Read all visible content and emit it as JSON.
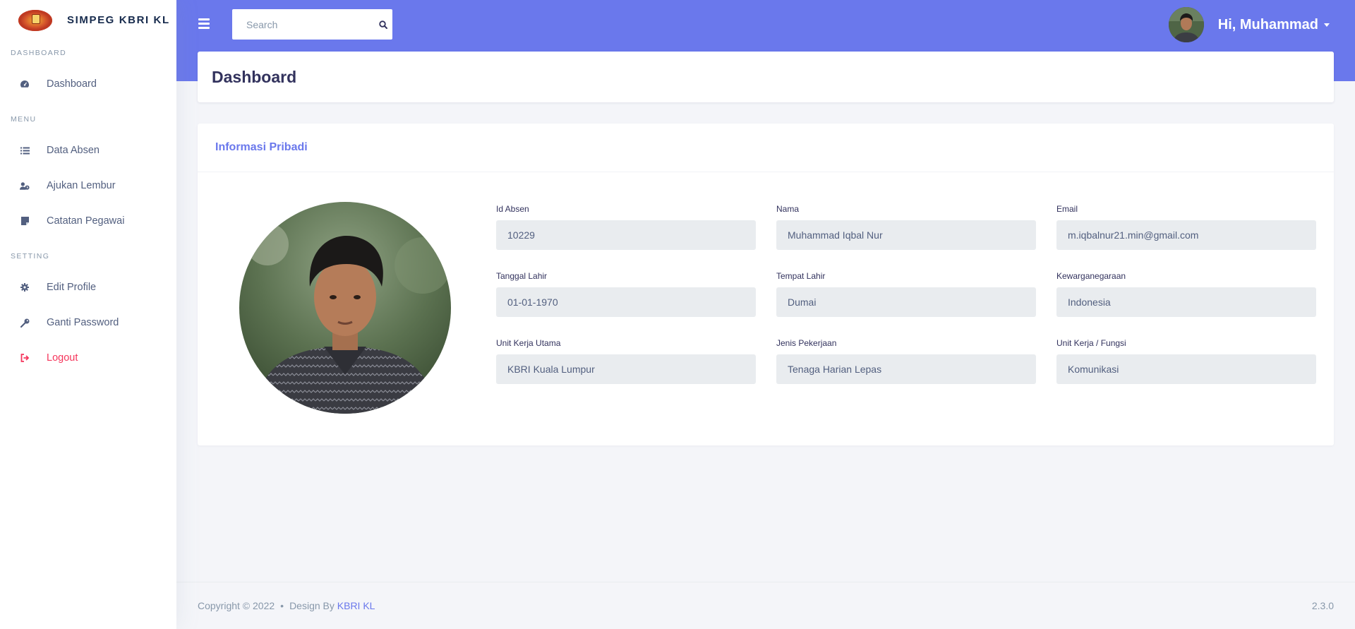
{
  "brand": {
    "name": "SIMPEG KBRI KL"
  },
  "sidebar": {
    "sections": [
      {
        "label": "DASHBOARD",
        "items": [
          {
            "label": "Dashboard",
            "icon": "dashboard-gauge-icon"
          }
        ]
      },
      {
        "label": "MENU",
        "items": [
          {
            "label": "Data Absen",
            "icon": "list-icon"
          },
          {
            "label": "Ajukan Lembur",
            "icon": "user-clock-icon"
          },
          {
            "label": "Catatan Pegawai",
            "icon": "note-icon"
          }
        ]
      },
      {
        "label": "SETTING",
        "items": [
          {
            "label": "Edit Profile",
            "icon": "gear-icon"
          },
          {
            "label": "Ganti Password",
            "icon": "key-icon"
          },
          {
            "label": "Logout",
            "icon": "logout-icon"
          }
        ]
      }
    ]
  },
  "header": {
    "search_placeholder": "Search",
    "greeting": "Hi, Muhammad"
  },
  "page": {
    "title": "Dashboard"
  },
  "info": {
    "title": "Informasi Pribadi",
    "fields": [
      {
        "label": "Id Absen",
        "value": "10229"
      },
      {
        "label": "Nama",
        "value": "Muhammad Iqbal Nur"
      },
      {
        "label": "Email",
        "value": "m.iqbalnur21.min@gmail.com"
      },
      {
        "label": "Tanggal Lahir",
        "value": "01-01-1970"
      },
      {
        "label": "Tempat Lahir",
        "value": "Dumai"
      },
      {
        "label": "Kewarganegaraan",
        "value": "Indonesia"
      },
      {
        "label": "Unit Kerja Utama",
        "value": "KBRI Kuala Lumpur"
      },
      {
        "label": "Jenis Pekerjaan",
        "value": "Tenaga Harian Lepas"
      },
      {
        "label": "Unit Kerja / Fungsi",
        "value": "Komunikasi"
      }
    ]
  },
  "footer": {
    "copyright": "Copyright © 2022",
    "design_by": "Design By",
    "design_link": "KBRI KL",
    "version": "2.3.0"
  },
  "colors": {
    "accent": "#6a78ec",
    "logout": "#f5365c",
    "field_bg": "#e9ecef"
  }
}
